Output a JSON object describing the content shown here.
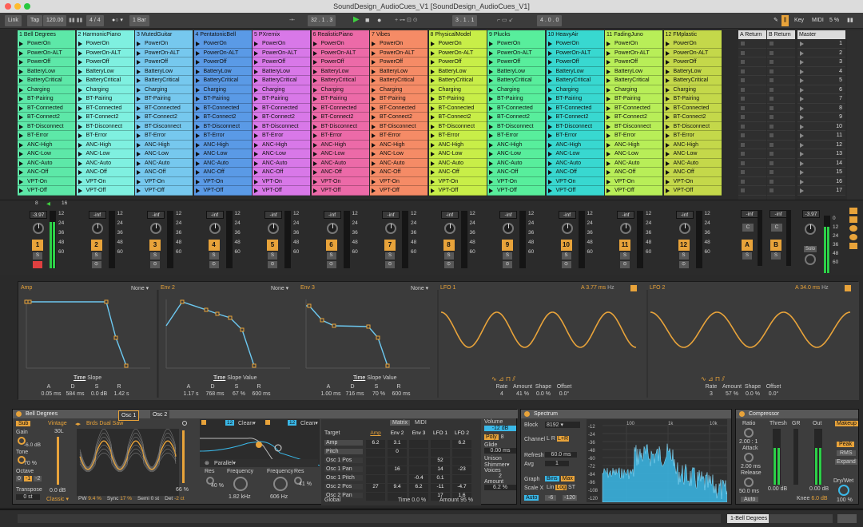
{
  "window": {
    "title": "SoundDesign_AudioCues_V1  [SoundDesign_AudioCues_V1]"
  },
  "toolbar": {
    "link": "Link",
    "tap": "Tap",
    "tempo": "120.00",
    "sig": "4 / 4",
    "quant": "1 Bar",
    "pos": "32 .  1 .  3",
    "loop_start": "3 .  1 .  1",
    "loop_len": "4 .  0 .  0",
    "key": "Key",
    "midi": "MIDI",
    "cpu": "5 %"
  },
  "tracks": [
    {
      "name": "1 Bell Degrees",
      "color": "#5de8a8",
      "num": "1",
      "vol": "-3.97"
    },
    {
      "name": "2 HarmonicPiano",
      "color": "#7ff0e0",
      "num": "2",
      "vol": "-inf"
    },
    {
      "name": "3 MutedGuitar",
      "color": "#76c8ee",
      "num": "3",
      "vol": "-inf"
    },
    {
      "name": "4 PentatonicBell",
      "color": "#5a9ae6",
      "num": "4",
      "vol": "-inf"
    },
    {
      "name": "5 PXremix",
      "color": "#d878e8",
      "num": "5",
      "vol": "-inf"
    },
    {
      "name": "6 RealisticPiano",
      "color": "#ec6aa8",
      "num": "6",
      "vol": "-inf"
    },
    {
      "name": "7 Vibes",
      "color": "#f58b66",
      "num": "7",
      "vol": "-inf"
    },
    {
      "name": "8 PhysicalModel",
      "color": "#c8ee48",
      "num": "8",
      "vol": "-inf"
    },
    {
      "name": "9 Plucks",
      "color": "#58ee9c",
      "num": "9",
      "vol": "-inf"
    },
    {
      "name": "10 HeavyAir",
      "color": "#38d8d0",
      "num": "10",
      "vol": "-inf"
    },
    {
      "name": "11 FadingJuno",
      "color": "#b8ee58",
      "num": "11",
      "vol": "-inf"
    },
    {
      "name": "12 FMplastic",
      "color": "#c4d84a",
      "num": "12",
      "vol": "-inf"
    }
  ],
  "clips": [
    "PowerOn",
    "PowerOn-ALT",
    "PowerOff",
    "BatteryLow",
    "BatteryCritical",
    "Charging",
    "BT-Pairing",
    "BT-Connected",
    "BT-Connect2",
    "BT-Disconnect",
    "BT-Error",
    "ANC-High",
    "ANC-Low",
    "ANC-Auto",
    "ANC-Off",
    "VPT-On",
    "VPT-Off"
  ],
  "returns": [
    {
      "name": "A Return",
      "letter": "A",
      "vol": "-inf"
    },
    {
      "name": "B Return",
      "letter": "B",
      "vol": "-inf"
    }
  ],
  "master": {
    "name": "Master",
    "scenes": [
      "1",
      "2",
      "3",
      "4",
      "5",
      "6",
      "7",
      "8",
      "9",
      "10",
      "11",
      "12",
      "13",
      "14",
      "15",
      "16",
      "17"
    ],
    "vol": "-3.97",
    "solo_label": "Solo"
  },
  "mixer": {
    "scale": [
      "12",
      "24",
      "36",
      "48",
      "60"
    ],
    "scale_master": [
      "0",
      "12",
      "24",
      "36",
      "48",
      "60"
    ],
    "c_label": "C",
    "s_label": "S",
    "sends": "8",
    "sends2": "16",
    "dash": "-"
  },
  "envs": [
    {
      "name": "Amp",
      "mode": "None",
      "a": "0.05 ms",
      "d": "584 ms",
      "s": "0.0 dB",
      "r": "1.42 s"
    },
    {
      "name": "Env 2",
      "mode": "None",
      "a": "1.17 s",
      "d": "768 ms",
      "s": "67 %",
      "r": "600 ms"
    },
    {
      "name": "Env 3",
      "mode": "None",
      "a": "1.00 ms",
      "d": "716 ms",
      "s": "70 %",
      "r": "600 ms"
    }
  ],
  "env_labels": {
    "time": "Time",
    "slope": "Slope",
    "value": "Value",
    "a": "A",
    "d": "D",
    "s": "S",
    "r": "R"
  },
  "lfos": [
    {
      "name": "LFO 1",
      "rate_label": "A",
      "rate": "3.77 ms",
      "hz": "Hz",
      "rate_v": "4",
      "amount": "41 %",
      "shape": "0.0 %",
      "offset": "0.0°"
    },
    {
      "name": "LFO 2",
      "rate_label": "A",
      "rate": "34.0 ms",
      "hz": "Hz",
      "rate_v": "3",
      "amount": "57 %",
      "shape": "0.0 %",
      "offset": "0.0°"
    }
  ],
  "lfo_labels": {
    "rate": "Rate",
    "amount": "Amount",
    "shape": "Shape",
    "offset": "Offset"
  },
  "synth": {
    "title": "Bell Degrees",
    "osc1": "Osc 1",
    "osc2": "Osc 2",
    "sub": "Sub",
    "gain": "Gain",
    "gain_v": "-6.0 dB",
    "tone": "Tone",
    "tone_v": "70 %",
    "octave": "Octave",
    "oct_opts": [
      "0",
      "-1",
      "-2"
    ],
    "transpose": "Transpose",
    "transpose_v": "0 st",
    "vintage": "Vintage",
    "wave": "Brds Dual Saw",
    "lvl": "30L",
    "lvl_db": "0.0 dB",
    "classic": "Classic",
    "pw": "PW",
    "pw_v": "9.4 %",
    "sync": "Sync",
    "sync_v": "17 %",
    "semi": "Semi",
    "semi_v": "0 st",
    "det": "Det",
    "det_v": "-2 ct",
    "pct": "66 %",
    "f1": "12",
    "clean": "Clean",
    "parallel": "Parallel",
    "res": "Res",
    "res_v": "40 %",
    "freq": "Frequency",
    "freq_v": "1.82 kHz",
    "freq2": "Frequency",
    "freq2_v": "606 Hz",
    "res2": "Res",
    "res2_v": "41 %"
  },
  "matrix": {
    "tabs": [
      "Matrix",
      "MIDI"
    ],
    "target": "Target",
    "cols": [
      "Amp",
      "Env 2",
      "Env 3",
      "LFO 1",
      "LFO 2"
    ],
    "rows": [
      "Amp",
      "Pitch",
      "Osc 1 Pos",
      "Osc 1 Pan",
      "Osc 1 Pitch",
      "Osc 2 Pos",
      "Osc 2 Pan"
    ],
    "global": "Global",
    "time": "Time",
    "time_v": "0.0 %",
    "amount": "Amount",
    "amount_v": "95 %",
    "vals": [
      [
        "6.2",
        "3.1",
        "",
        "",
        "6.2"
      ],
      [
        "",
        "0",
        "",
        "",
        ""
      ],
      [
        "",
        "",
        "",
        "52",
        ""
      ],
      [
        "",
        "16",
        "",
        "14",
        "-23"
      ],
      [
        "",
        "",
        "-0.4",
        "0.1",
        ""
      ],
      [
        "27",
        "9.4",
        "6.2",
        "-11",
        "-4.7"
      ],
      [
        "",
        "",
        "",
        "17",
        "1.6"
      ]
    ],
    "volume": "Volume",
    "volume_v": "-12 dB",
    "poly": "Poly",
    "voices_n": "8",
    "glide": "Glide",
    "glide_v": "0.00 ms",
    "unison": "Unison",
    "shimmer": "Shimmer",
    "voices": "Voices",
    "voices_v": "2",
    "amount2": "Amount",
    "amount2_v": "6.2 %"
  },
  "spectrum": {
    "title": "Spectrum",
    "block": "Block",
    "block_v": "8192",
    "channel": "Channel",
    "ch_opts": [
      "L",
      "R",
      "L+R"
    ],
    "refresh": "Refresh",
    "refresh_v": "60.0 ms",
    "avg": "Avg",
    "avg_v": "1",
    "graph": "Graph",
    "graph_opts": [
      "Bins",
      "Max"
    ],
    "scalex": "Scale X",
    "scale_opts": [
      "Lin",
      "Log",
      "ST"
    ],
    "auto": "Auto",
    "lo": "-6",
    "hi": "-120",
    "freqs": [
      "100",
      "1k",
      "10k"
    ],
    "db": [
      "-12",
      "-24",
      "-36",
      "-48",
      "-60",
      "-72",
      "-84",
      "-96",
      "-108",
      "-120"
    ]
  },
  "comp": {
    "title": "Compressor",
    "ratio": "Ratio",
    "ratio_v": "2.00 : 1",
    "attack": "Attack",
    "attack_v": "2.00 ms",
    "release": "Release",
    "release_v": "50.0 ms",
    "auto": "Auto",
    "thresh": "Thresh",
    "gr": "GR",
    "out": "Out",
    "thresh_v": "0.00 dB",
    "out_v": "0.00 dB",
    "knee": "Knee",
    "knee_v": "6.0 dB",
    "makeup": "Makeup",
    "peak": "Peak",
    "rms": "RMS",
    "expand": "Expand",
    "drywet": "Dry/Wet",
    "drywet_v": "100 %"
  },
  "status": {
    "track": "1-Bell Degrees"
  }
}
